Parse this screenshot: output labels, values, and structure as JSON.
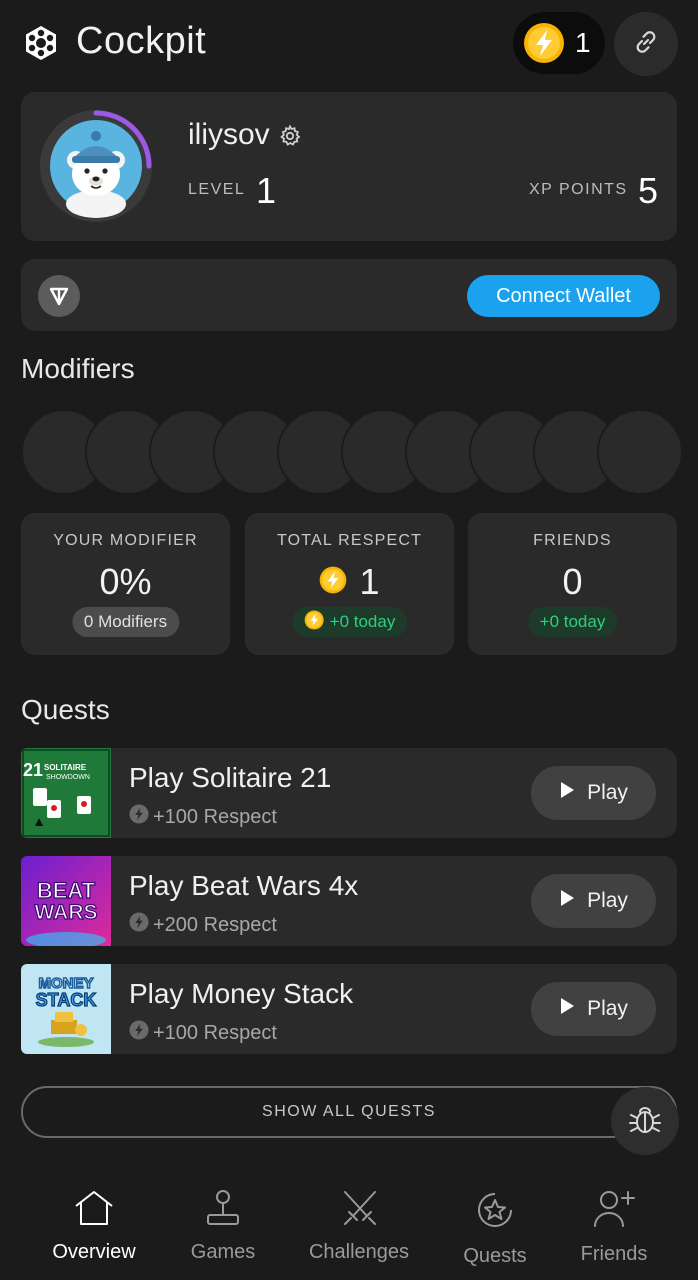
{
  "header": {
    "title": "Cockpit",
    "balance": "1",
    "logo_icon": "hexagon-logo-icon",
    "link_icon": "link-icon"
  },
  "profile": {
    "username": "iliysov",
    "level_label": "LEVEL",
    "level": "1",
    "xp_label": "XP POINTS",
    "xp": "5",
    "xp_progress": 0.25
  },
  "wallet": {
    "connect_label": "Connect Wallet"
  },
  "modifiers": {
    "title": "Modifiers",
    "slot_count": 10
  },
  "stats": [
    {
      "label": "YOUR MODIFIER",
      "value": "0%",
      "badge": "0 Modifiers",
      "badge_style": "grey",
      "has_coin": false,
      "badge_coin": false
    },
    {
      "label": "TOTAL RESPECT",
      "value": "1",
      "badge": "+0 today",
      "badge_style": "green",
      "has_coin": true,
      "badge_coin": true
    },
    {
      "label": "FRIENDS",
      "value": "0",
      "badge": "+0 today",
      "badge_style": "green",
      "has_coin": false,
      "badge_coin": false
    }
  ],
  "quests": {
    "title": "Quests",
    "play_label": "Play",
    "items": [
      {
        "name": "Play Solitaire 21",
        "reward": "+100 Respect",
        "thumb_text": "21 SOLITAIRE SHOWDOWN"
      },
      {
        "name": "Play Beat Wars 4x",
        "reward": "+200 Respect",
        "thumb_text": "BEAT WARS"
      },
      {
        "name": "Play Money Stack",
        "reward": "+100 Respect",
        "thumb_text": "MONEY STACK"
      }
    ],
    "show_all_label": "SHOW ALL QUESTS"
  },
  "nav": [
    {
      "label": "Overview",
      "icon": "home-icon",
      "active": true
    },
    {
      "label": "Games",
      "icon": "joystick-icon",
      "active": false
    },
    {
      "label": "Challenges",
      "icon": "crossed-swords-icon",
      "active": false
    },
    {
      "label": "Quests",
      "icon": "star-badge-icon",
      "active": false
    },
    {
      "label": "Friends",
      "icon": "add-user-icon",
      "active": false
    }
  ],
  "colors": {
    "background": "#1b1b1b",
    "card": "#2a2a2a",
    "accent_blue": "#1aa2ee",
    "progress_purple": "#9b59e8",
    "coin_yellow": "#f7b500",
    "green": "#2fcf7e"
  }
}
